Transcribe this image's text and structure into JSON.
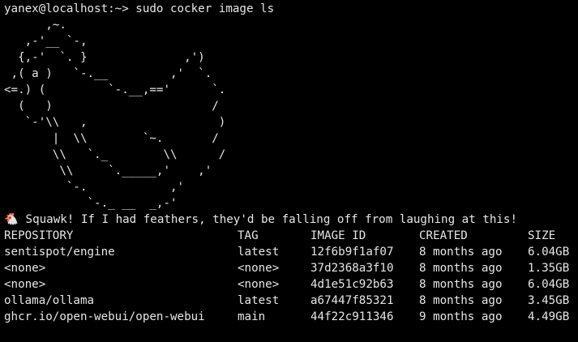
{
  "prompt": {
    "text": "yanex@localhost:~> sudo cocker image ls"
  },
  "ascii_art": "      ,~.\n   ,-'__ `-,\n  {,-'  `. }              ,')\n ,( a )   `-.__         ,'  `.\n<=.) (         `-.__,=='      `.\n  (   )                       /\n   `-'\\\\   ,                   )\n       |  \\\\        `~.       /\n       \\\\   `._        \\\\      /\n        \\\\     `._____,'    ,'\n         `-.            ,'\n            `-._ __  _,-'",
  "message": {
    "icon": "chicken-icon",
    "text": " Squawk! If I had feathers, they'd be falling off from laughing at this!"
  },
  "images_table": {
    "headers": {
      "repository": "REPOSITORY",
      "tag": "TAG",
      "image_id": "IMAGE ID",
      "created": "CREATED",
      "size": "SIZE"
    },
    "rows": [
      {
        "repository": "sentispot/engine",
        "tag": "latest",
        "image_id": "12f6b9f1af07",
        "created": "8 months ago",
        "size": "6.04GB"
      },
      {
        "repository": "<none>",
        "tag": "<none>",
        "image_id": "37d2368a3f10",
        "created": "8 months ago",
        "size": "1.35GB"
      },
      {
        "repository": "<none>",
        "tag": "<none>",
        "image_id": "4d1e51c92b63",
        "created": "8 months ago",
        "size": "6.04GB"
      },
      {
        "repository": "ollama/ollama",
        "tag": "latest",
        "image_id": "a67447f85321",
        "created": "8 months ago",
        "size": "3.45GB"
      },
      {
        "repository": "ghcr.io/open-webui/open-webui",
        "tag": "main",
        "image_id": "44f22c911346",
        "created": "9 months ago",
        "size": "4.49GB"
      }
    ]
  }
}
